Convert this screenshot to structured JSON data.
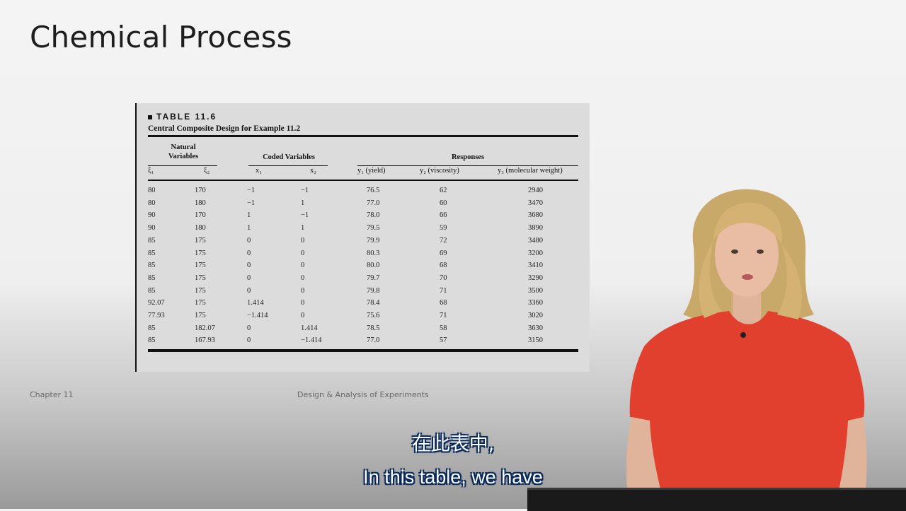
{
  "slide": {
    "title": "Chemical Process",
    "footer_left": "Chapter 11",
    "footer_center": "Design & Analysis of Experiments"
  },
  "table": {
    "heading": "TABLE 11.6",
    "caption": "Central Composite Design for Example 11.2",
    "group_headers": {
      "natural_line1": "Natural",
      "natural_line2": "Variables",
      "coded": "Coded Variables",
      "responses": "Responses"
    },
    "columns": [
      "ξ₁",
      "ξ₂",
      "x₁",
      "x₂",
      "y₁ (yield)",
      "y₂ (viscosity)",
      "y₃ (molecular weight)"
    ],
    "rows": [
      [
        "80",
        "170",
        "−1",
        "−1",
        "76.5",
        "62",
        "2940"
      ],
      [
        "80",
        "180",
        "−1",
        "1",
        "77.0",
        "60",
        "3470"
      ],
      [
        "90",
        "170",
        "1",
        "−1",
        "78.0",
        "66",
        "3680"
      ],
      [
        "90",
        "180",
        "1",
        "1",
        "79.5",
        "59",
        "3890"
      ],
      [
        "85",
        "175",
        "0",
        "0",
        "79.9",
        "72",
        "3480"
      ],
      [
        "85",
        "175",
        "0",
        "0",
        "80.3",
        "69",
        "3200"
      ],
      [
        "85",
        "175",
        "0",
        "0",
        "80.0",
        "68",
        "3410"
      ],
      [
        "85",
        "175",
        "0",
        "0",
        "79.7",
        "70",
        "3290"
      ],
      [
        "85",
        "175",
        "0",
        "0",
        "79.8",
        "71",
        "3500"
      ],
      [
        "92.07",
        "175",
        "1.414",
        "0",
        "78.4",
        "68",
        "3360"
      ],
      [
        "77.93",
        "175",
        "−1.414",
        "0",
        "75.6",
        "71",
        "3020"
      ],
      [
        "85",
        "182.07",
        "0",
        "1.414",
        "78.5",
        "58",
        "3630"
      ],
      [
        "85",
        "167.93",
        "0",
        "−1.414",
        "77.0",
        "57",
        "3150"
      ]
    ]
  },
  "subtitles": {
    "zh": "在此表中,",
    "en": "In this table, we have"
  },
  "colors": {
    "table_bg": "#dcdcdc",
    "presenter_shirt": "#e2402f",
    "subtitle_outline": "#0a2a5c"
  }
}
